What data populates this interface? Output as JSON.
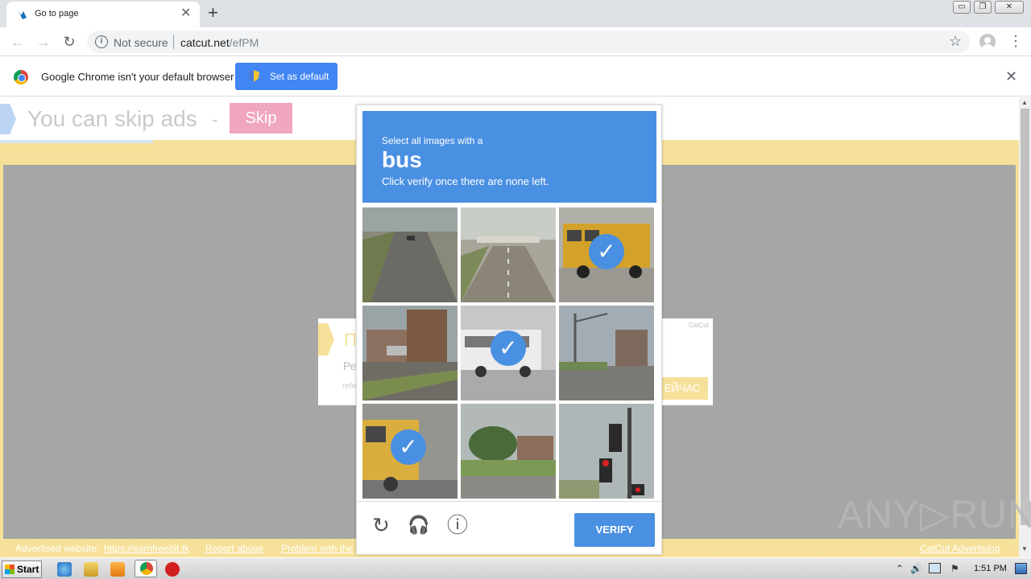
{
  "browser": {
    "tab_title": "Go to page",
    "tab_close": "✕",
    "new_tab": "+",
    "back": "←",
    "forward": "→",
    "reload": "↻",
    "security_label": "Not secure",
    "url_host": "catcut.net",
    "url_path": "/efPM",
    "star": "☆",
    "menu": "⋮",
    "win_minimize": "▭",
    "win_restore": "❐",
    "win_close": "✕"
  },
  "infobar": {
    "message": "Google Chrome isn't your default browser",
    "set_default_label": "Set as default",
    "close": "✕"
  },
  "page": {
    "skip_text": "You can skip ads",
    "skip_dash": "-",
    "skip_button": "Skip",
    "ad_title": "П",
    "ad_subtitle": "Ре",
    "ad_ref": "refe",
    "ad_brand": "CatCut",
    "ad_button": "ЕЙЧАС",
    "footer_advertised": "Advertised website:",
    "footer_link": "https://earnfreebit.tk",
    "footer_report": "Report abuse",
    "footer_problem": "Problem with the",
    "footer_brand": "CatCut Advertising"
  },
  "captcha": {
    "instruction": "Select all images with a",
    "keyword": "bus",
    "hint": "Click verify once there are none left.",
    "tiles": [
      {
        "name": "highway-road",
        "selected": false
      },
      {
        "name": "road-overpass",
        "selected": false
      },
      {
        "name": "school-bus",
        "selected": true
      },
      {
        "name": "street-buildings",
        "selected": false
      },
      {
        "name": "white-bus",
        "selected": true
      },
      {
        "name": "intersection",
        "selected": false
      },
      {
        "name": "yellow-bus",
        "selected": true
      },
      {
        "name": "trees-lot",
        "selected": false
      },
      {
        "name": "traffic-light",
        "selected": false
      }
    ],
    "check_mark": "✓",
    "reload_icon": "↻",
    "audio_icon": "🎧",
    "info_icon": "ⓘ",
    "verify_label": "VERIFY"
  },
  "watermark": "ANY▷RUN",
  "taskbar": {
    "start_label": "Start",
    "clock": "1:51 PM",
    "tray_up": "⌃",
    "tray_volume": "🔊",
    "tray_flag": "⚑"
  },
  "colors": {
    "captcha_blue": "#4a90e2",
    "page_yellow": "#f6e19a",
    "skip_pink": "#f0a6bd",
    "chrome_blue": "#4285f4"
  }
}
